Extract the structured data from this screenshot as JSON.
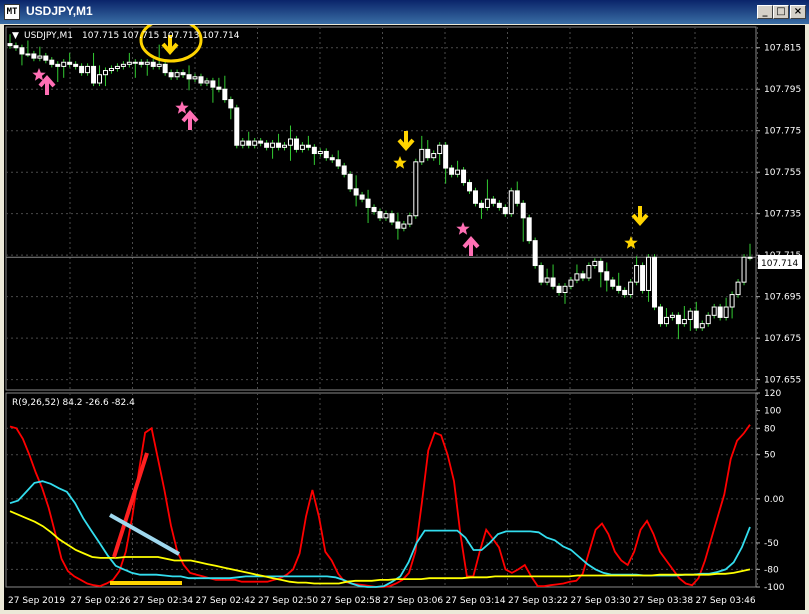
{
  "window": {
    "title": "USDJPY,M1",
    "app_icon_glyph": "MT",
    "buttons": {
      "minimize": "_",
      "maximize": "□",
      "close": "×"
    }
  },
  "price_panel": {
    "header_symbol": "USDJPY,M1",
    "header_values": "107.715 107.715 107.713 107.714",
    "current_price_label": "107.714",
    "y_ticks": [
      "107.815",
      "107.795",
      "107.775",
      "107.755",
      "107.735",
      "107.715",
      "107.695",
      "107.675",
      "107.655"
    ]
  },
  "indicator_panel": {
    "header": "R(9,26,52) 84.2 -26.6 -82.4",
    "y_ticks": [
      "120",
      "100",
      "80",
      "50",
      "0.00",
      "-50",
      "-80",
      "-100"
    ]
  },
  "time_axis": {
    "labels": [
      "27 Sep 2019",
      "27 Sep 02:26",
      "27 Sep 02:34",
      "27 Sep 02:42",
      "27 Sep 02:50",
      "27 Sep 02:58",
      "27 Sep 03:06",
      "27 Sep 03:14",
      "27 Sep 03:22",
      "27 Sep 03:30",
      "27 Sep 03:38",
      "27 Sep 03:46"
    ]
  },
  "colors": {
    "background": "#000000",
    "grid": "#4a4a4a",
    "text": "#ffffff",
    "bull_candle": "#ffffff",
    "bear_candle": "#ffffff",
    "wick": "#33cc33",
    "red_line": "#ff0000",
    "cyan_line": "#33ddee",
    "yellow_line": "#ffff00",
    "marker_pink": "#ff6fb4",
    "marker_yellow": "#ffd400"
  },
  "chart_data": {
    "type": "candlestick",
    "symbol": "USDJPY",
    "timeframe": "M1",
    "ylim": [
      107.65,
      107.825
    ],
    "closes": [
      107.816,
      107.815,
      107.812,
      107.812,
      107.81,
      107.811,
      107.809,
      107.807,
      107.806,
      107.808,
      107.807,
      107.806,
      107.803,
      107.806,
      107.798,
      107.802,
      107.804,
      107.805,
      107.806,
      107.807,
      107.808,
      107.808,
      107.807,
      107.808,
      107.806,
      107.807,
      107.803,
      107.801,
      107.803,
      107.802,
      107.8,
      107.801,
      107.798,
      107.799,
      107.796,
      107.795,
      107.79,
      107.786,
      107.768,
      107.77,
      107.768,
      107.77,
      107.769,
      107.767,
      107.769,
      107.767,
      107.768,
      107.771,
      107.766,
      107.768,
      107.767,
      107.764,
      107.765,
      107.762,
      107.761,
      107.758,
      107.754,
      107.747,
      107.744,
      107.742,
      107.738,
      107.736,
      107.733,
      107.735,
      107.731,
      107.728,
      107.73,
      107.734,
      107.76,
      107.766,
      107.762,
      107.764,
      107.768,
      107.757,
      107.754,
      107.756,
      107.75,
      107.746,
      107.74,
      107.738,
      107.742,
      107.74,
      107.738,
      107.735,
      107.746,
      107.74,
      107.733,
      107.722,
      107.71,
      107.702,
      107.704,
      107.7,
      107.697,
      107.7,
      107.703,
      107.706,
      107.704,
      107.71,
      107.712,
      107.707,
      107.703,
      107.7,
      107.698,
      107.696,
      107.702,
      107.71,
      107.698,
      107.714,
      107.69,
      107.682,
      107.685,
      107.686,
      107.682,
      107.684,
      107.688,
      107.68,
      107.682,
      107.686,
      107.69,
      107.685,
      107.69,
      107.696,
      107.702,
      107.714,
      107.714
    ],
    "series": [
      {
        "values": [
          82,
          80,
          68,
          50,
          30,
          12,
          -10,
          -38,
          -68,
          -82,
          -88,
          -92,
          -96,
          -98,
          -99,
          -96,
          -92,
          -82,
          -60,
          -20,
          30,
          75,
          80,
          45,
          10,
          -30,
          -60,
          -75,
          -84,
          -86,
          -88,
          -90,
          -92,
          -92,
          -92,
          -92,
          -94,
          -94,
          -94,
          -94,
          -94,
          -92,
          -90,
          -86,
          -80,
          -62,
          -20,
          10,
          -20,
          -60,
          -70,
          -85,
          -94,
          -96,
          -97,
          -98,
          -99,
          -100,
          -100,
          -99,
          -96,
          -92,
          -84,
          -60,
          -5,
          55,
          75,
          72,
          50,
          20,
          -40,
          -88,
          -88,
          -60,
          -35,
          -45,
          -55,
          -80,
          -84,
          -80,
          -75,
          -88,
          -99,
          -99,
          -98,
          -97,
          -96,
          -94,
          -93,
          -85,
          -60,
          -35,
          -28,
          -40,
          -60,
          -70,
          -75,
          -60,
          -35,
          -25,
          -40,
          -60,
          -70,
          -80,
          -90,
          -96,
          -98,
          -90,
          -70,
          -45,
          -20,
          5,
          45,
          66,
          74,
          84
        ]
      },
      {
        "values": [
          -5,
          -2,
          8,
          18,
          20,
          17,
          12,
          8,
          -5,
          -22,
          -36,
          -50,
          -64,
          -76,
          -80,
          -84,
          -86,
          -86,
          -86,
          -87,
          -88,
          -88,
          -90,
          -90,
          -90,
          -90,
          -90,
          -90,
          -89,
          -88,
          -88,
          -88,
          -88,
          -88,
          -88,
          -88,
          -88,
          -88,
          -88,
          -88,
          -89,
          -92,
          -96,
          -99,
          -100,
          -100,
          -99,
          -94,
          -88,
          -72,
          -50,
          -36,
          -36,
          -36,
          -36,
          -36,
          -44,
          -58,
          -58,
          -50,
          -40,
          -37,
          -37,
          -37,
          -37,
          -38,
          -44,
          -47,
          -54,
          -58,
          -66,
          -74,
          -80,
          -84,
          -86,
          -86,
          -86,
          -86,
          -87,
          -87,
          -87,
          -87,
          -87,
          -86,
          -86,
          -85,
          -85,
          -83,
          -80,
          -72,
          -55,
          -32
        ]
      },
      {
        "values": [
          -14,
          -18,
          -22,
          -26,
          -31,
          -38,
          -46,
          -52,
          -58,
          -62,
          -66,
          -67,
          -67,
          -67,
          -66,
          -66,
          -66,
          -66,
          -66,
          -68,
          -70,
          -70,
          -70,
          -72,
          -74,
          -76,
          -78,
          -80,
          -82,
          -84,
          -86,
          -88,
          -90,
          -92,
          -94,
          -95,
          -95,
          -96,
          -96,
          -96,
          -96,
          -94,
          -93,
          -93,
          -93,
          -92,
          -92,
          -91,
          -91,
          -91,
          -91,
          -90,
          -90,
          -90,
          -90,
          -90,
          -89,
          -89,
          -89,
          -88,
          -88,
          -88,
          -88,
          -88,
          -88,
          -88,
          -88,
          -88,
          -88,
          -87,
          -87,
          -87,
          -87,
          -87,
          -87,
          -87,
          -87,
          -87,
          -87,
          -86,
          -86,
          -86,
          -86,
          -86,
          -86,
          -86,
          -85,
          -85,
          -84,
          -82,
          -80
        ]
      }
    ],
    "indicator_ylim": [
      -100,
      120
    ]
  }
}
